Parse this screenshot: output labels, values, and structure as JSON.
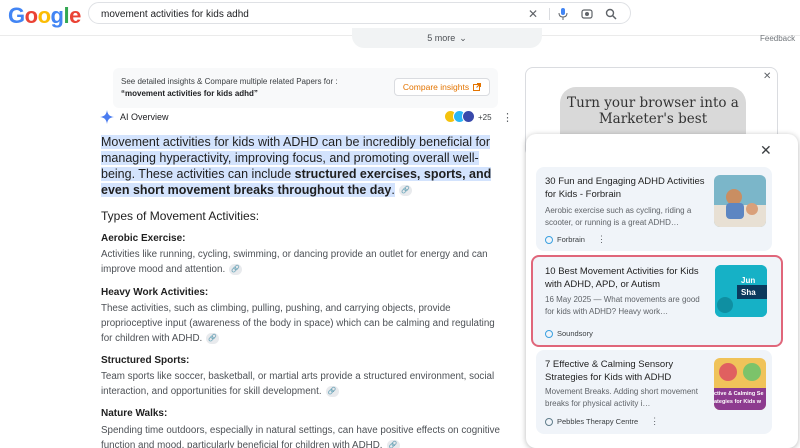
{
  "header": {
    "logo": [
      "G",
      "o",
      "o",
      "g",
      "l",
      "e"
    ],
    "logo_colors": [
      "#4285f4",
      "#ea4335",
      "#fbbc05",
      "#4285f4",
      "#34a853",
      "#ea4335"
    ],
    "query": "movement activities for kids adhd"
  },
  "top_strip": {
    "more_label": "5 more",
    "feedback": "Feedback"
  },
  "insights": {
    "line1": "See detailed insights & Compare multiple related Papers for :",
    "line2": "“movement activities for kids adhd”",
    "button": "Compare insights"
  },
  "ai_overview": {
    "label": "AI Overview",
    "source_count": "+25",
    "source_colors": [
      "#f4c20d",
      "#29b6f6",
      "#3949ab"
    ],
    "lead_plain": "Movement activities for kids with ADHD can be incredibly beneficial for managing hyperactivity, improving focus, and promoting overall well-being. These activities can include ",
    "lead_bold": "structured exercises, sports, and even short movement breaks throughout the day",
    "lead_end": ".",
    "types_heading": "Types of Movement Activities:",
    "sections": [
      {
        "title": "Aerobic Exercise:",
        "text": "Activities like running, cycling, swimming, or dancing provide an outlet for energy and can improve mood and attention."
      },
      {
        "title": "Heavy Work Activities:",
        "text": "These activities, such as climbing, pulling, pushing, and carrying objects, provide proprioceptive input (awareness of the body in space) which can be calming and regulating for children with ADHD."
      },
      {
        "title": "Structured Sports:",
        "text": "Team sports like soccer, basketball, or martial arts provide a structured environment, social interaction, and opportunities for skill development."
      },
      {
        "title": "Nature Walks:",
        "text": "Spending time outdoors, especially in natural settings, can have positive effects on cognitive function and mood, particularly beneficial for children with ADHD."
      }
    ]
  },
  "ad": {
    "sign_text": "Turn your browser into a Marketer's best"
  },
  "popup": {
    "cards": [
      {
        "title": "30 Fun and Engaging ADHD Activities for Kids - Forbrain",
        "snippet": "Aerobic exercise such as cycling, riding a scooter, or running is a great ADHD…",
        "source": "Forbrain"
      },
      {
        "title": "10 Best Movement Activities for Kids with ADHD, APD, or Autism",
        "snippet": "16 May 2025 — What movements are good for kids with ADHD? Heavy work…",
        "source": "Soundsory",
        "thumb_text": "Jun\nSha"
      },
      {
        "title": "7 Effective & Calming Sensory Strategies for Kids with ADHD",
        "snippet": "Movement Breaks. Adding short movement breaks for physical activity i…",
        "source": "Pebbles Therapy Centre",
        "thumb_text": "ctive & Calming Se\nategies for Kids w"
      }
    ]
  }
}
